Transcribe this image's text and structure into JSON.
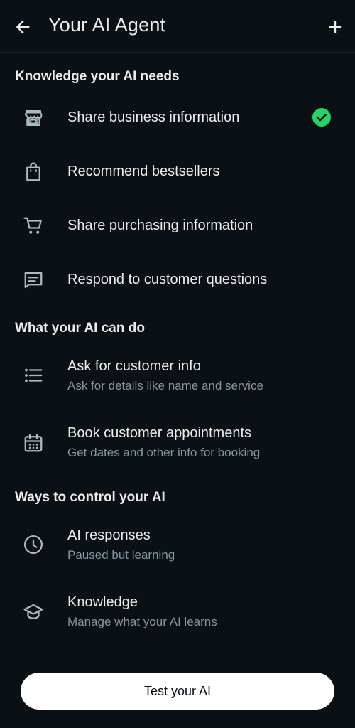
{
  "header": {
    "back_icon": "arrow-left-icon",
    "title": "Your AI Agent",
    "add_icon": "plus-icon"
  },
  "sections": [
    {
      "title": "Knowledge your AI needs",
      "items": [
        {
          "label": "Share business information",
          "icon": "storefront-icon",
          "completed": true
        },
        {
          "label": "Recommend bestsellers",
          "icon": "shopping-bag-icon"
        },
        {
          "label": "Share purchasing information",
          "icon": "cart-icon"
        },
        {
          "label": "Respond to customer questions",
          "icon": "message-box-icon"
        }
      ]
    },
    {
      "title": "What your AI can do",
      "items": [
        {
          "label": "Ask for customer info",
          "subtitle": "Ask for details like name and service",
          "icon": "list-icon"
        },
        {
          "label": "Book customer appointments",
          "subtitle": "Get dates and other info for booking",
          "icon": "calendar-icon"
        }
      ]
    },
    {
      "title": "Ways to control your AI",
      "items": [
        {
          "label": "AI responses",
          "subtitle": "Paused but learning",
          "icon": "clock-icon"
        },
        {
          "label": "Knowledge",
          "subtitle": "Manage what your AI learns",
          "icon": "graduation-cap-icon"
        }
      ]
    }
  ],
  "footer": {
    "test_button_label": "Test your AI"
  },
  "colors": {
    "background": "#0b1014",
    "text_primary": "#e9edef",
    "text_secondary": "#8696a0",
    "icon": "#aebac1",
    "success": "#25d366",
    "button_bg": "#ffffff"
  }
}
